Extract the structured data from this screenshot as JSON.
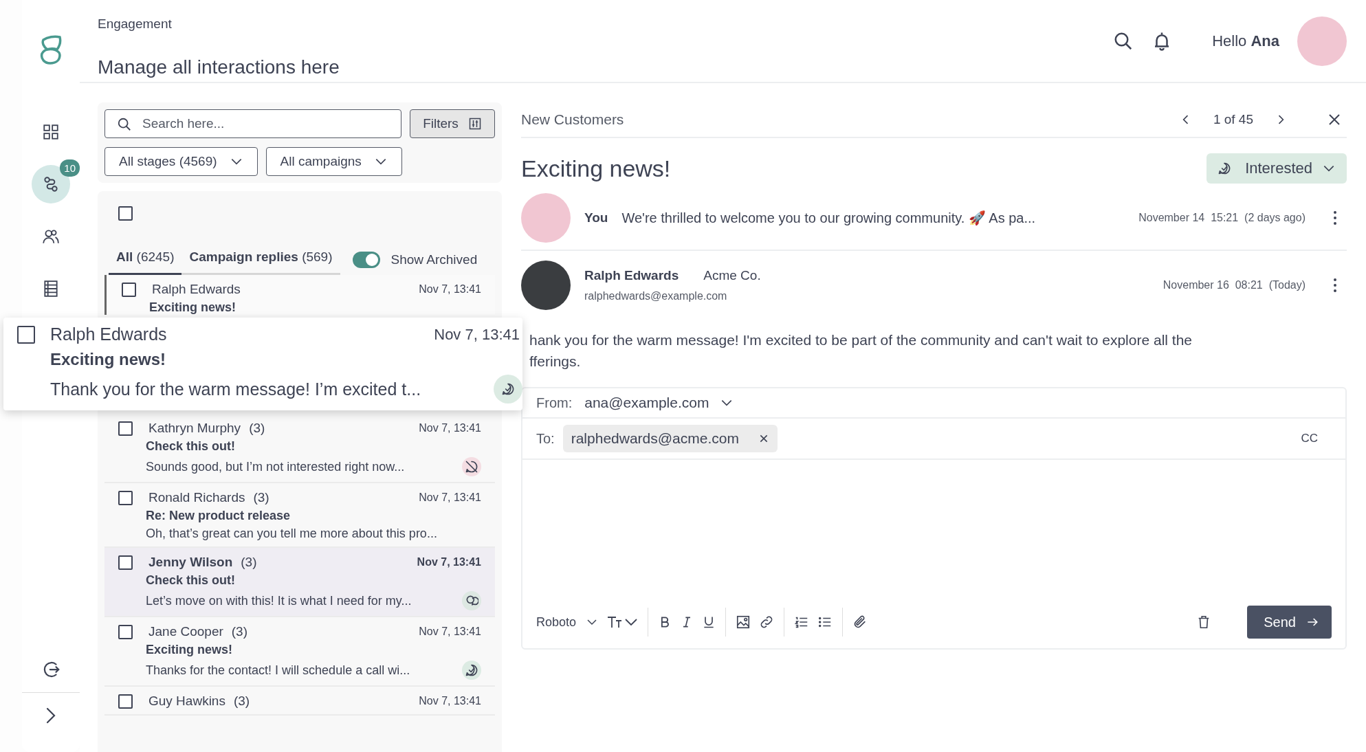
{
  "header": {
    "breadcrumb": "Engagement",
    "title": "Manage all interactions here",
    "greeting": "Hello",
    "user_name": "Ana"
  },
  "sidebar": {
    "items": [
      {
        "kind": "grid",
        "selected": false
      },
      {
        "kind": "flow",
        "selected": true,
        "badge": "10"
      },
      {
        "kind": "people",
        "selected": false
      },
      {
        "kind": "table",
        "selected": false
      }
    ],
    "bottom": [
      {
        "kind": "logout"
      },
      {
        "kind": "expand"
      }
    ]
  },
  "filters": {
    "search_placeholder": "Search here...",
    "filters_button": "Filters",
    "dropdowns": [
      "All stages (4569)",
      "All campaigns"
    ]
  },
  "list": {
    "select_all_checked": false,
    "tabs": [
      {
        "label": "All",
        "count": "(6245)",
        "selected": true
      },
      {
        "label": "Campaign replies",
        "count": "(569)",
        "selected": false
      }
    ],
    "show_archived": {
      "label": "Show Archived",
      "on": true
    },
    "rows": [
      {
        "name": "Ralph Edwards",
        "date": "Nov 7, 13:41",
        "subject": "Exciting news!",
        "checked": false,
        "selected": false,
        "drop_target": true
      },
      {
        "name": "Kathryn Murphy",
        "count": "(3)",
        "date": "Nov 7, 13:41",
        "subject": "Check this out!",
        "preview": "Sounds good, but I’m not interested right now...",
        "kind": "declined",
        "checked": false,
        "selected": false,
        "drop_target": false
      },
      {
        "name": "Ronald Richards",
        "count": "(3)",
        "date": "Nov 7, 13:41",
        "subject": "Re: New product release",
        "preview": "Oh, that’s great can you tell me more about this pro...",
        "checked": false,
        "selected": false,
        "drop_target": false
      },
      {
        "name": "Jenny Wilson",
        "count": "(3)",
        "date": "Nov 7, 13:41",
        "subject": "Check this out!",
        "preview": "Let’s move on with this! It is what I need for my...",
        "kind": "discussing",
        "checked": false,
        "selected": true,
        "drop_target": false
      },
      {
        "name": "Jane Cooper",
        "count": "(3)",
        "date": "Nov 7, 13:41",
        "subject": "Exciting news!",
        "preview": "Thanks for the contact! I will schedule a call wi...",
        "kind": "interested",
        "checked": false,
        "selected": false,
        "drop_target": false
      },
      {
        "name": "Guy Hawkins",
        "count": "(3)",
        "date": "Nov 7, 13:41",
        "checked": false,
        "selected": false,
        "drop_target": false
      }
    ]
  },
  "dragged_card": {
    "name": "Ralph Edwards",
    "date": "Nov 7, 13:41",
    "subject": "Exciting news!",
    "preview": "Thank you for the warm message! I’m excited t...",
    "kind": "interested",
    "checked": false
  },
  "detail": {
    "list_name": "New Customers",
    "pager": "1 of 45",
    "subject": "Exciting news!",
    "stage": {
      "label": "Interested",
      "kind": "interested"
    },
    "messages": [
      {
        "kind": "sent",
        "sender": "You",
        "text": "We're thrilled to welcome you to our growing community. 🚀 As pa...",
        "date": "November 14",
        "time": "15:21",
        "relative": "(2 days ago)"
      },
      {
        "kind": "received",
        "sender": "Ralph Edwards",
        "company": "Acme Co.",
        "email": "ralphedwards@example.com",
        "date": "November 16",
        "time": "08:21",
        "relative": "(Today)",
        "body": [
          "hank you for the warm message! I'm excited to be part of the community and can't wait to explore all the",
          "fferings."
        ]
      }
    ]
  },
  "composer": {
    "from_label": "From:",
    "from": "ana@example.com",
    "to_label": "To:",
    "recipients": [
      "ralphedwards@acme.com"
    ],
    "cc": "CC",
    "font": "Roboto",
    "send": "Send"
  }
}
